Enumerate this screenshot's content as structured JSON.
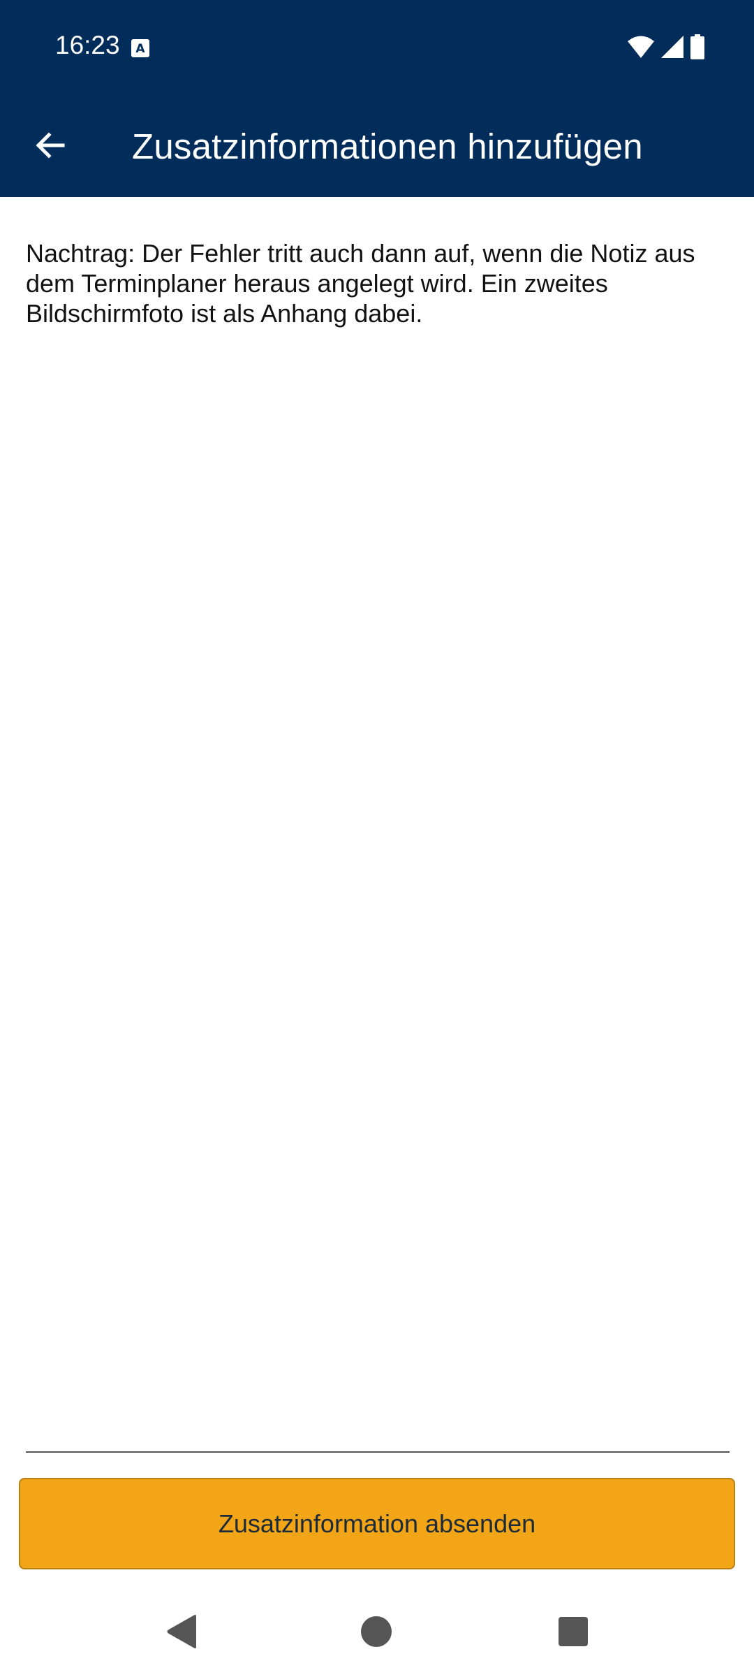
{
  "status_bar": {
    "time": "16:23",
    "icons": [
      "accessibility-a-icon",
      "wifi-icon",
      "signal-icon",
      "battery-icon"
    ]
  },
  "app_bar": {
    "back_icon": "arrow-left-icon",
    "title": "Zusatzinformationen hinzufügen"
  },
  "form": {
    "text_value": "Nachtrag: Der Fehler tritt auch dann auf, wenn die Notiz aus dem Terminplaner heraus angelegt wird. Ein zweites Bildschirmfoto ist als Anhang dabei.",
    "submit_label": "Zusatzinformation absenden"
  },
  "nav_bar": {
    "icons": [
      "nav-back-icon",
      "nav-home-icon",
      "nav-recents-icon"
    ]
  },
  "colors": {
    "header_bg": "#022c5a",
    "button_bg": "#f2a516",
    "text": "#111111"
  }
}
